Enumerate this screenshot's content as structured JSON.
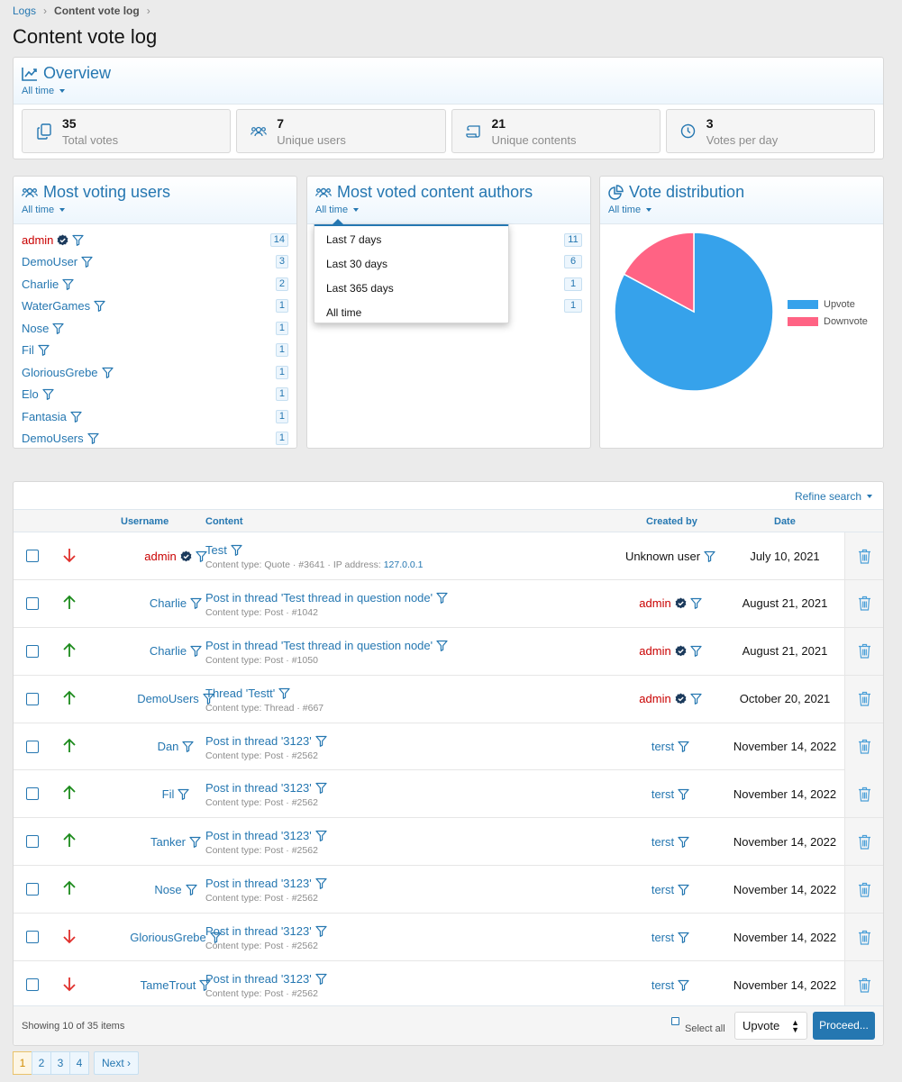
{
  "breadcrumb": {
    "items": [
      "Logs",
      "Content vote log"
    ]
  },
  "page_title": "Content vote log",
  "overview": {
    "title": "Overview",
    "filter": "All time",
    "stats": [
      {
        "value": "35",
        "label": "Total votes",
        "icon": "copy-icon"
      },
      {
        "value": "7",
        "label": "Unique users",
        "icon": "users-icon"
      },
      {
        "value": "21",
        "label": "Unique contents",
        "icon": "scroll-icon"
      },
      {
        "value": "3",
        "label": "Votes per day",
        "icon": "clock-icon"
      }
    ]
  },
  "most_voting_users": {
    "title": "Most voting users",
    "filter": "All time",
    "items": [
      {
        "name": "admin",
        "count": "14"
      },
      {
        "name": "DemoUser",
        "count": "3"
      },
      {
        "name": "Charlie",
        "count": "2"
      },
      {
        "name": "WaterGames",
        "count": "1"
      },
      {
        "name": "Nose",
        "count": "1"
      },
      {
        "name": "Fil",
        "count": "1"
      },
      {
        "name": "GloriousGrebe",
        "count": "1"
      },
      {
        "name": "Elo",
        "count": "1"
      },
      {
        "name": "Fantasia",
        "count": "1"
      },
      {
        "name": "DemoUsers",
        "count": "1"
      }
    ]
  },
  "most_voted_authors": {
    "title": "Most voted content authors",
    "filter": "All time",
    "counts": [
      "11",
      "6",
      "1",
      "1"
    ],
    "dropdown": [
      "Last 7 days",
      "Last 30 days",
      "Last 365 days",
      "All time"
    ]
  },
  "vote_distribution": {
    "title": "Vote distribution",
    "filter": "All time"
  },
  "chart_data": {
    "type": "pie",
    "labels": [
      "Upvote",
      "Downvote"
    ],
    "values": [
      29,
      6
    ],
    "colors": [
      "#36a2eb",
      "#ff6384"
    ]
  },
  "table": {
    "refine": "Refine search",
    "headers": {
      "username": "Username",
      "content": "Content",
      "created_by": "Created by",
      "date": "Date"
    },
    "rows": [
      {
        "dir": "down",
        "user": "admin",
        "user_admin": true,
        "title": "Test",
        "meta": "Content type: Quote · #3641 · IP address: ",
        "ip": "127.0.0.1",
        "creator": "Unknown user",
        "creator_type": "plain",
        "date": "July 10, 2021"
      },
      {
        "dir": "up",
        "user": "Charlie",
        "user_admin": false,
        "title": "Post in thread 'Test thread in question node'",
        "meta": "Content type: Post · #1042",
        "ip": "",
        "creator": "admin",
        "creator_type": "admin",
        "date": "August 21, 2021"
      },
      {
        "dir": "up",
        "user": "Charlie",
        "user_admin": false,
        "title": "Post in thread 'Test thread in question node'",
        "meta": "Content type: Post · #1050",
        "ip": "",
        "creator": "admin",
        "creator_type": "admin",
        "date": "August 21, 2021"
      },
      {
        "dir": "up",
        "user": "DemoUsers",
        "user_admin": false,
        "title": "Thread 'Testt'",
        "meta": "Content type: Thread · #667",
        "ip": "",
        "creator": "admin",
        "creator_type": "admin",
        "date": "October 20, 2021"
      },
      {
        "dir": "up",
        "user": "Dan",
        "user_admin": false,
        "title": "Post in thread '3123'",
        "meta": "Content type: Post · #2562",
        "ip": "",
        "creator": "terst",
        "creator_type": "link",
        "date": "November 14, 2022"
      },
      {
        "dir": "up",
        "user": "Fil",
        "user_admin": false,
        "title": "Post in thread '3123'",
        "meta": "Content type: Post · #2562",
        "ip": "",
        "creator": "terst",
        "creator_type": "link",
        "date": "November 14, 2022"
      },
      {
        "dir": "up",
        "user": "Tanker",
        "user_admin": false,
        "title": "Post in thread '3123'",
        "meta": "Content type: Post · #2562",
        "ip": "",
        "creator": "terst",
        "creator_type": "link",
        "date": "November 14, 2022"
      },
      {
        "dir": "up",
        "user": "Nose",
        "user_admin": false,
        "title": "Post in thread '3123'",
        "meta": "Content type: Post · #2562",
        "ip": "",
        "creator": "terst",
        "creator_type": "link",
        "date": "November 14, 2022"
      },
      {
        "dir": "down",
        "user": "GloriousGrebe",
        "user_admin": false,
        "title": "Post in thread '3123'",
        "meta": "Content type: Post · #2562",
        "ip": "",
        "creator": "terst",
        "creator_type": "link",
        "date": "November 14, 2022"
      },
      {
        "dir": "down",
        "user": "TameTrout",
        "user_admin": false,
        "title": "Post in thread '3123'",
        "meta": "Content type: Post · #2562",
        "ip": "",
        "creator": "terst",
        "creator_type": "link",
        "date": "November 14, 2022"
      }
    ],
    "footer": {
      "showing": "Showing 10 of 35 items",
      "select_all": "Select all",
      "action": "Upvote",
      "proceed": "Proceed..."
    }
  },
  "pagination": {
    "pages": [
      "1",
      "2",
      "3",
      "4"
    ],
    "current": "1",
    "next": "Next"
  },
  "colors": {
    "accent": "#2577b1",
    "admin": "#c90000",
    "upvote_arrow": "#1b8a1b",
    "downvote_arrow": "#e0302c"
  }
}
